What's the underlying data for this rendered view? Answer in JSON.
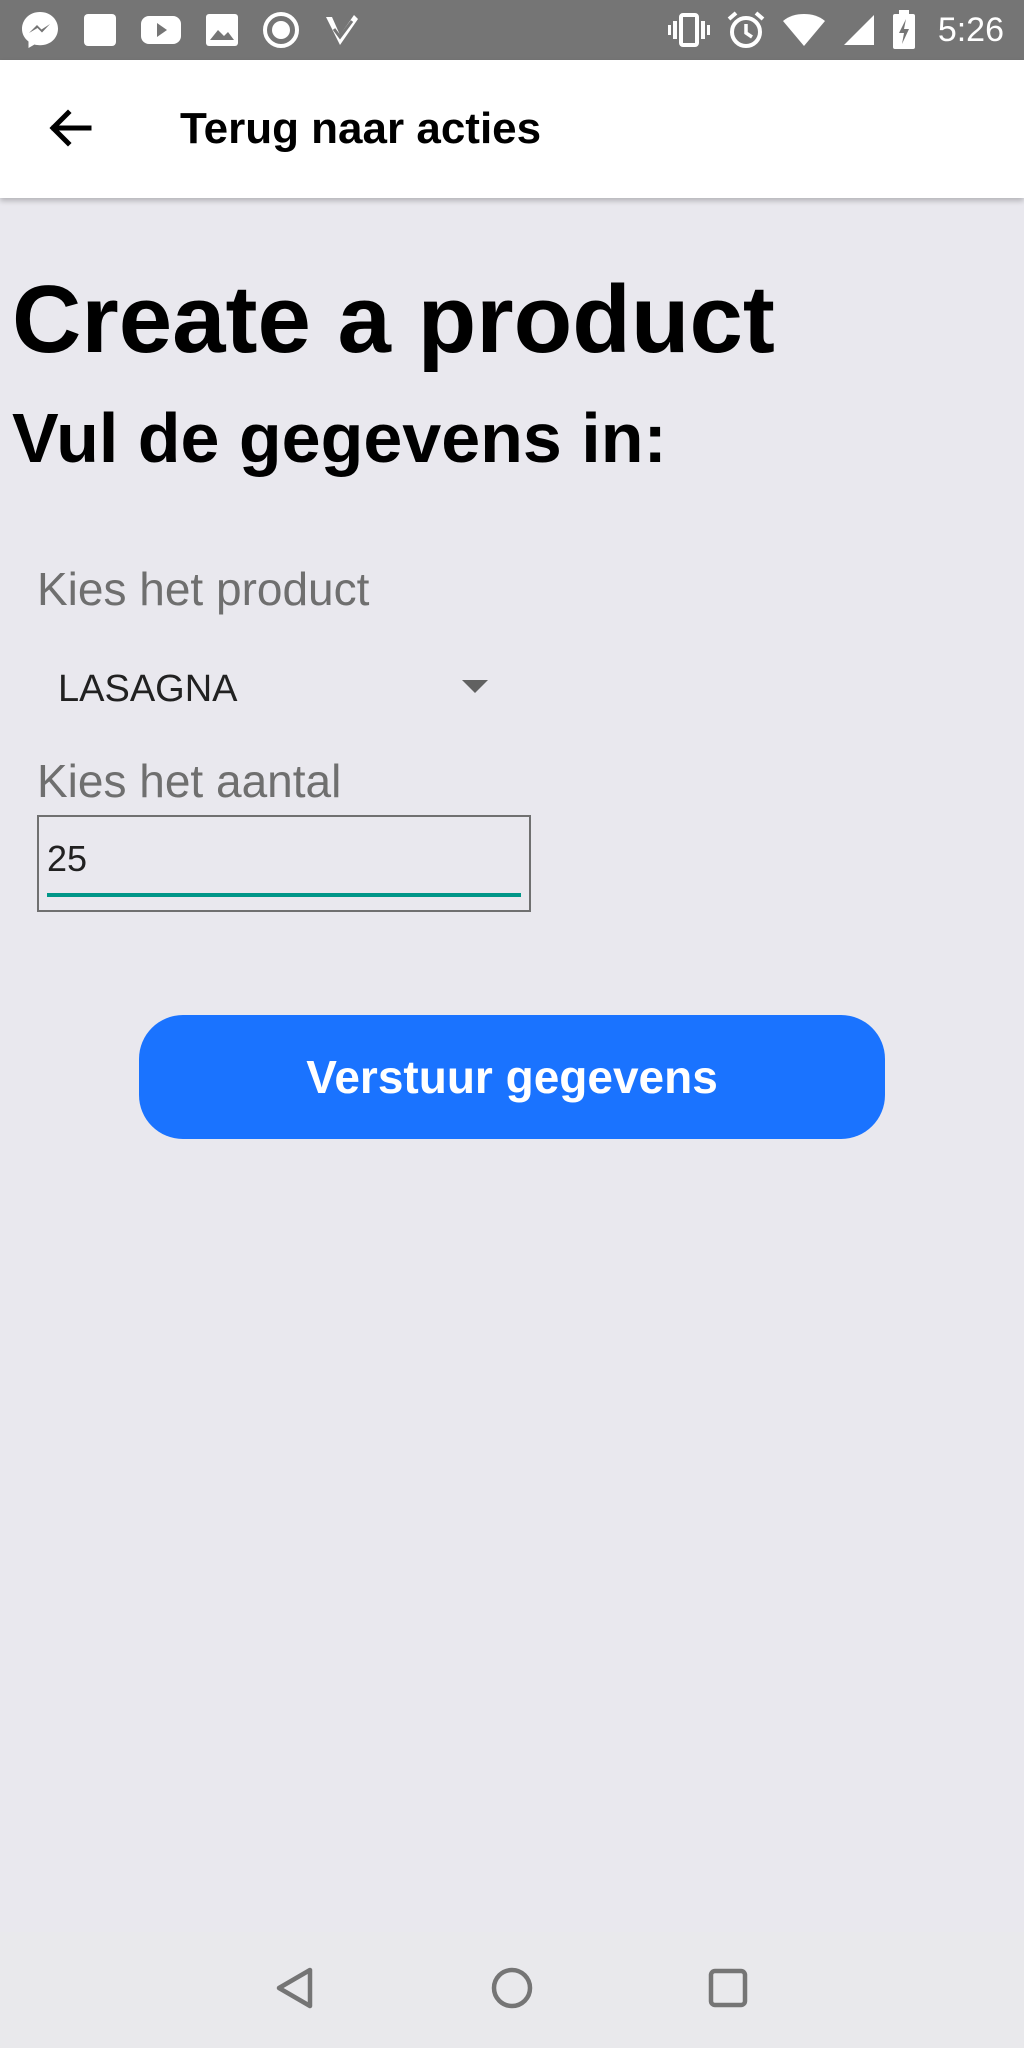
{
  "status_bar": {
    "time": "5:26",
    "left_icons": [
      "messenger-icon",
      "notification-square-icon",
      "youtube-icon",
      "photos-icon",
      "record-icon",
      "todo-check-icon"
    ],
    "right_icons": [
      "vibrate-icon",
      "alarm-icon",
      "wifi-icon",
      "signal-icon",
      "battery-charging-icon"
    ]
  },
  "app_bar": {
    "back_icon": "arrow-left-icon",
    "title": "Terug naar acties"
  },
  "page": {
    "title": "Create a product",
    "subtitle": "Vul de gegevens in:"
  },
  "form": {
    "product_label": "Kies het product",
    "product_value": "LASAGNA",
    "quantity_label": "Kies het aantal",
    "quantity_value": "25",
    "submit_label": "Verstuur gegevens"
  },
  "colors": {
    "background": "#e9e8ee",
    "status_bar": "#757575",
    "button": "#1a73ff",
    "input_underline": "#009688"
  },
  "nav_bar": {
    "icons": [
      "nav-back-icon",
      "nav-home-icon",
      "nav-recents-icon"
    ]
  }
}
